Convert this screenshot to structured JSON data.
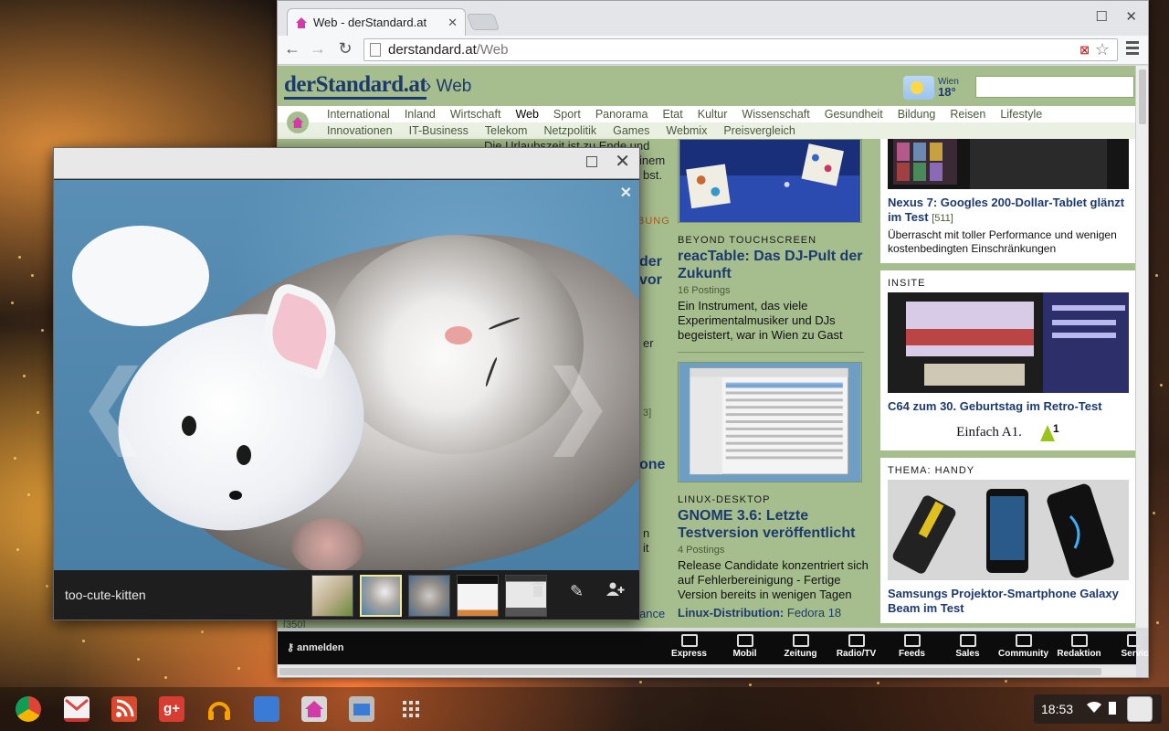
{
  "browser": {
    "tab_title": "Web - derStandard.at",
    "tab_close": "✕",
    "url_host": "derstandard.at",
    "url_path": "/Web",
    "back": "←",
    "forward": "→",
    "reload": "↻",
    "star": "☆",
    "maximize": "☐",
    "close": "✕"
  },
  "site": {
    "logo": "derStandard.at",
    "section": "› Web",
    "weather_city": "Wien",
    "weather_temp": "18°",
    "nav_primary": [
      "International",
      "Inland",
      "Wirtschaft",
      "Web",
      "Sport",
      "Panorama",
      "Etat",
      "Kultur",
      "Wissenschaft",
      "Gesundheit",
      "Bildung",
      "Reisen",
      "Lifestyle"
    ],
    "nav_active": "Web",
    "nav_secondary": [
      "Innovationen",
      "IT-Business",
      "Telekom",
      "Netzpolitik",
      "Games",
      "Webmix",
      "Preisvergleich"
    ],
    "left_col": {
      "snippet1": "Die Urlaubszeit ist zu Ende und",
      "snippet2": "inem",
      "snippet3": "bst.",
      "kicker_fragment": "BUNG",
      "h1": "der",
      "h2": "vor",
      "s4": "er",
      "s5": "3]",
      "h3": "one",
      "s6": "n",
      "s7": "it",
      "s8": "ance",
      "s9": "[350]"
    },
    "mid_col": {
      "article1_kicker": "BEYOND TOUCHSCREEN",
      "article1_headline": "reacTable: Das DJ-Pult der Zukunft",
      "article1_postings": "16 Postings",
      "article1_teaser": "Ein Instrument, das viele Experimentalmusiker und DJs begeistert, war in Wien zu Gast",
      "article2_kicker": "LINUX-DESKTOP",
      "article2_headline": "GNOME 3.6: Letzte Testversion veröffentlicht",
      "article2_postings": "4 Postings",
      "article2_teaser": "Release Candidate konzentriert sich auf Fehlerbereinigung - Fertige Version bereits in wenigen Tagen",
      "article3_headline": "Linux-Distribution:",
      "article3_rest": "Fedora 18"
    },
    "right_col": {
      "nexus_headline": "Nexus 7: Googles 200-Dollar-Tablet glänzt im Test",
      "nexus_count": "[511]",
      "nexus_teaser": "Überrascht mit toller Performance und wenigen kostenbedingten Einschränkungen",
      "insite_kicker": "INSITE",
      "c64_headline": "C64 zum 30. Geburtstag im Retro-Test",
      "ad_text": "Einfach A1.",
      "handy_kicker": "THEMA: HANDY",
      "samsung_headline": "Samsungs Projektor-Smartphone Galaxy Beam im Test"
    },
    "bottom_nav": {
      "login": "anmelden",
      "items": [
        "Express",
        "Mobil",
        "Zeitung",
        "Radio/TV",
        "Feeds",
        "Sales",
        "Community",
        "Redaktion",
        "Servic"
      ]
    }
  },
  "viewer": {
    "filename": "too-cute-kitten",
    "close": "✕",
    "photo_close": "✕",
    "prev": "❮",
    "next": "❯",
    "delete_icon": "🗑",
    "edit_icon": "✎",
    "share_icon": "👤+",
    "selected_thumb_index": 1
  },
  "shelf": {
    "time": "18:53",
    "apps": [
      "chrome",
      "gmail",
      "rss",
      "google-plus",
      "music",
      "files",
      "derstandard",
      "files-blue",
      "app-launcher"
    ]
  },
  "colors": {
    "site_bg": "#a6bd8d",
    "site_link": "#1d3a6e",
    "viewer_bar": "#1e1e1e",
    "thumb_selected": "#f2e79a"
  }
}
